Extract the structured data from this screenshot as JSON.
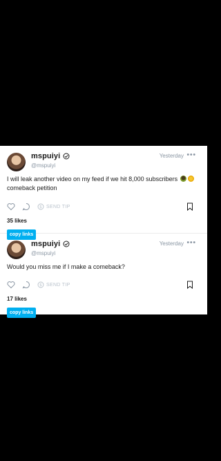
{
  "posts": [
    {
      "username": "mspuiyi",
      "handle": "@mspuiyi",
      "time": "Yesterday",
      "text_before_emoji": "I will leak another video on my feed if we hit 8,000 subscribers",
      "text_after_emoji": "comeback petition",
      "emojis": [
        "money-bag-emoji",
        "sunflower-emoji"
      ],
      "send_tip_label": "SEND TIP",
      "likes": "35 likes",
      "copy_links_label": "copy links"
    },
    {
      "username": "mspuiyi",
      "handle": "@mspuiyi",
      "time": "Yesterday",
      "text": "Would you miss me if I make a comeback?",
      "send_tip_label": "SEND TIP",
      "likes": "17 likes",
      "copy_links_label": "copy links"
    }
  ],
  "colors": {
    "background": "#000000",
    "card": "#ffffff",
    "accent": "#00aff0",
    "muted": "#8a96a3"
  },
  "icons": [
    "verified-icon",
    "more-options-icon",
    "heart-icon",
    "comment-icon",
    "tip-icon",
    "bookmark-icon"
  ]
}
